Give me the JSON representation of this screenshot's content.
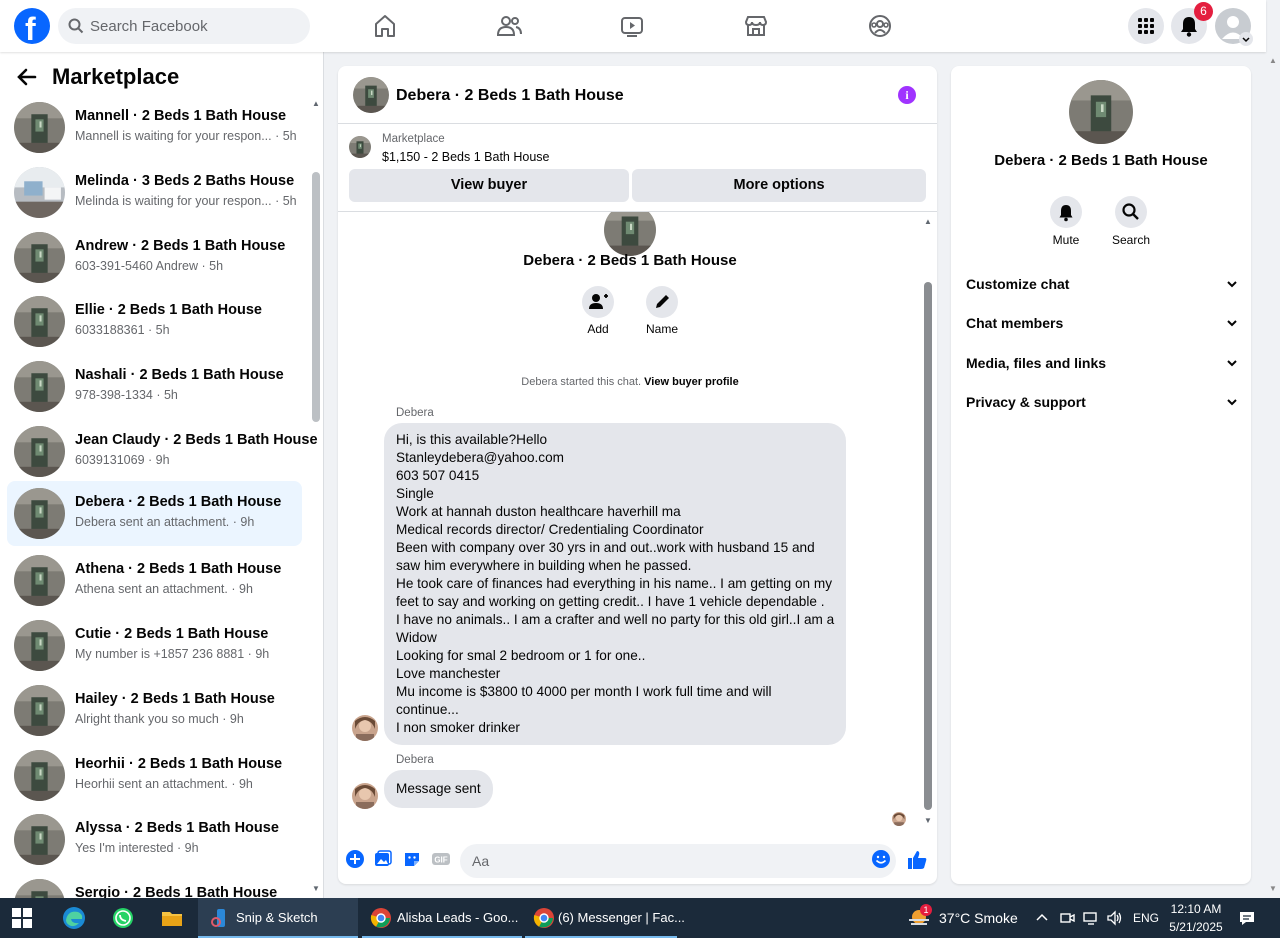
{
  "header": {
    "logo": "f",
    "search_placeholder": "Search Facebook",
    "notification_count": "6"
  },
  "left": {
    "title": "Marketplace",
    "conversations": [
      {
        "name": "Mannell · 2 Beds 1 Bath House",
        "sub": "Mannell is waiting for your respon... · 5h"
      },
      {
        "name": "Melinda · 3 Beds 2 Baths House",
        "sub": "Melinda is waiting for your respon... · 5h"
      },
      {
        "name": "Andrew · 2 Beds 1 Bath House",
        "sub": "603-391-5460 Andrew · 5h"
      },
      {
        "name": "Ellie · 2 Beds 1 Bath House",
        "sub": "6033188361 · 5h"
      },
      {
        "name": "Nashali · 2 Beds 1 Bath House",
        "sub": "978-398-1334 · 5h"
      },
      {
        "name": "Jean Claudy · 2 Beds 1 Bath House",
        "sub": "6039131069 · 9h"
      },
      {
        "name": "Debera · 2 Beds 1 Bath House",
        "sub": "Debera sent an attachment. · 9h"
      },
      {
        "name": "Athena · 2 Beds 1 Bath House",
        "sub": "Athena sent an attachment. · 9h"
      },
      {
        "name": "Cutie · 2 Beds 1 Bath House",
        "sub": "My number is +1857 236 8881 · 9h"
      },
      {
        "name": "Hailey · 2 Beds 1 Bath House",
        "sub": "Alright thank you so much · 9h"
      },
      {
        "name": "Heorhii · 2 Beds 1 Bath House",
        "sub": "Heorhii sent an attachment. · 9h"
      },
      {
        "name": "Alyssa · 2 Beds 1 Bath House",
        "sub": "Yes I'm interested · 9h"
      },
      {
        "name": "Sergio · 2 Beds 1 Bath House",
        "sub": ""
      }
    ]
  },
  "chat": {
    "title": "Debera · 2 Beds 1 Bath House",
    "marketplace_label": "Marketplace",
    "listing": "$1,150 - 2 Beds 1 Bath House",
    "view_buyer": "View buyer",
    "more_options": "More options",
    "center_name": "Debera · 2 Beds 1 Bath House",
    "add_label": "Add",
    "name_label": "Name",
    "started_text": "Debera started this chat.",
    "view_profile": "View buyer profile",
    "sender": "Debera",
    "message_lines": [
      "Hi, is this available?Hello",
      "Stanleydebera@yahoo.com",
      "603 507 0415",
      "Single",
      "Work at hannah duston healthcare haverhill ma",
      "Medical records director/ Credentialing Coordinator",
      "Been with company over 30 yrs in and out..work with husband 15 and",
      "saw him everywhere in building when he passed.",
      "He took care of finances had everything in his name.. I am getting on my",
      "feet to say and working on getting  credit.. I have 1 vehicle dependable .",
      "I have no animals.. I am a crafter and well no party for this old girl..I am a",
      "Widow",
      "Looking for smal 2 bedroom or 1 for one..",
      "Love manchester",
      "Mu income is $3800 t0 4000 per month I work full time and will",
      "continue...",
      "I non smoker drinker"
    ],
    "sender2": "Debera",
    "message2": "Message sent",
    "input_placeholder": "Aa"
  },
  "right": {
    "name": "Debera · 2 Beds 1 Bath House",
    "mute": "Mute",
    "search": "Search",
    "sections": [
      "Customize chat",
      "Chat members",
      "Media, files and links",
      "Privacy & support"
    ]
  },
  "taskbar": {
    "apps": [
      "Snip & Sketch",
      "Alisba Leads - Goo...",
      "(6) Messenger | Fac..."
    ],
    "weather_badge": "1",
    "weather": "37°C  Smoke",
    "lang": "ENG",
    "time": "12:10 AM",
    "date": "5/21/2025"
  },
  "colors": {
    "brand": "#0866ff",
    "active_conversation": "#ebf5ff",
    "info_icon": "#a033ff",
    "badge": "#e41e3f"
  }
}
